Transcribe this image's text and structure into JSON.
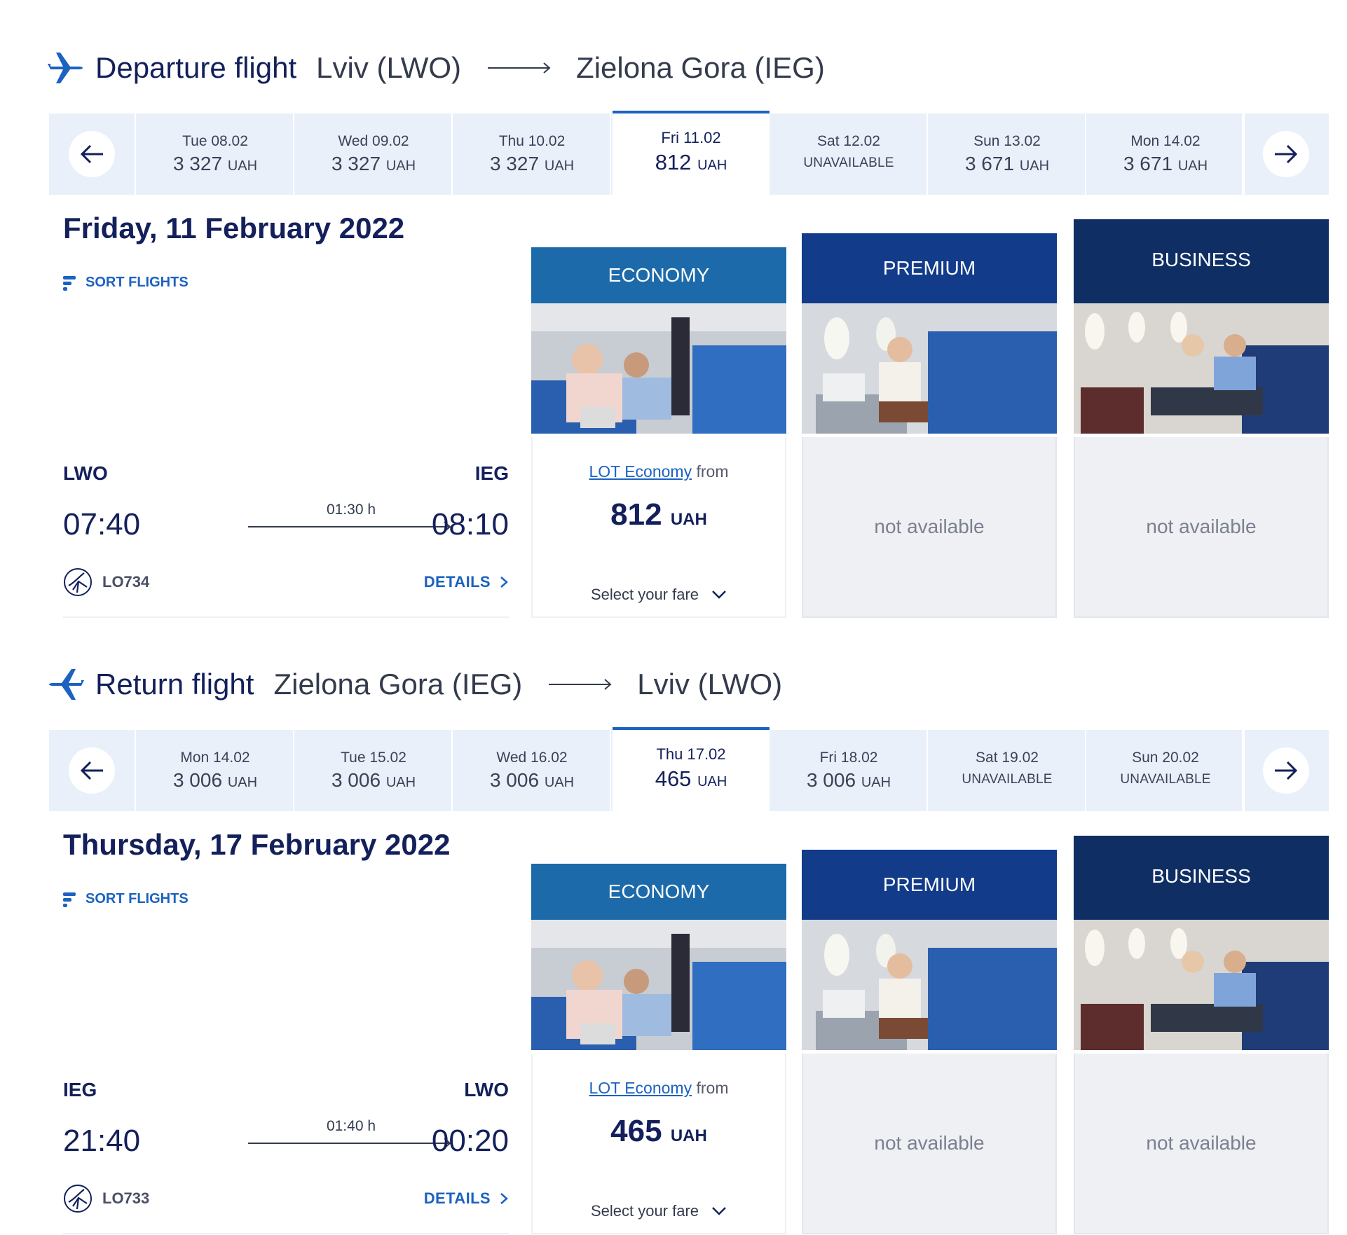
{
  "departure": {
    "header": {
      "label": "Departure flight",
      "from_city": "Lviv (LWO)",
      "to_city": "Zielona Gora (IEG)"
    },
    "dates": [
      {
        "label": "Tue 08.02",
        "amount": "3 327",
        "currency": "UAH",
        "unavailable_text": ""
      },
      {
        "label": "Wed 09.02",
        "amount": "3 327",
        "currency": "UAH",
        "unavailable_text": ""
      },
      {
        "label": "Thu 10.02",
        "amount": "3 327",
        "currency": "UAH",
        "unavailable_text": ""
      },
      {
        "label": "Fri 11.02",
        "amount": "812",
        "currency": "UAH",
        "unavailable_text": "",
        "selected": true
      },
      {
        "label": "Sat 12.02",
        "amount": "",
        "currency": "",
        "unavailable_text": "UNAVAILABLE"
      },
      {
        "label": "Sun 13.02",
        "amount": "3 671",
        "currency": "UAH",
        "unavailable_text": ""
      },
      {
        "label": "Mon 14.02",
        "amount": "3 671",
        "currency": "UAH",
        "unavailable_text": ""
      }
    ],
    "date_title": "Friday, 11 February 2022",
    "sort_label": "SORT FLIGHTS",
    "flight": {
      "from_code": "LWO",
      "to_code": "IEG",
      "dep_time": "07:40",
      "arr_time": "08:10",
      "duration": "01:30 h",
      "flight_no": "LO734",
      "details_label": "DETAILS"
    },
    "fares": {
      "economy": {
        "title": "ECONOMY",
        "link": "LOT Economy",
        "from": "from",
        "price": "812",
        "currency": "UAH",
        "select_label": "Select your fare"
      },
      "premium": {
        "title": "PREMIUM",
        "status": "not available"
      },
      "business": {
        "title": "BUSINESS",
        "status": "not available"
      }
    }
  },
  "return": {
    "header": {
      "label": "Return flight",
      "from_city": "Zielona Gora (IEG)",
      "to_city": "Lviv (LWO)"
    },
    "dates": [
      {
        "label": "Mon 14.02",
        "amount": "3 006",
        "currency": "UAH",
        "unavailable_text": ""
      },
      {
        "label": "Tue 15.02",
        "amount": "3 006",
        "currency": "UAH",
        "unavailable_text": ""
      },
      {
        "label": "Wed 16.02",
        "amount": "3 006",
        "currency": "UAH",
        "unavailable_text": ""
      },
      {
        "label": "Thu 17.02",
        "amount": "465",
        "currency": "UAH",
        "unavailable_text": "",
        "selected": true
      },
      {
        "label": "Fri 18.02",
        "amount": "3 006",
        "currency": "UAH",
        "unavailable_text": ""
      },
      {
        "label": "Sat 19.02",
        "amount": "",
        "currency": "",
        "unavailable_text": "UNAVAILABLE"
      },
      {
        "label": "Sun 20.02",
        "amount": "",
        "currency": "",
        "unavailable_text": "UNAVAILABLE"
      }
    ],
    "date_title": "Thursday, 17 February 2022",
    "sort_label": "SORT FLIGHTS",
    "flight": {
      "from_code": "IEG",
      "to_code": "LWO",
      "dep_time": "21:40",
      "arr_time": "00:20",
      "duration": "01:40 h",
      "flight_no": "LO733",
      "details_label": "DETAILS"
    },
    "fares": {
      "economy": {
        "title": "ECONOMY",
        "link": "LOT Economy",
        "from": "from",
        "price": "465",
        "currency": "UAH",
        "select_label": "Select your fare"
      },
      "premium": {
        "title": "PREMIUM",
        "status": "not available"
      },
      "business": {
        "title": "BUSINESS",
        "status": "not available"
      }
    }
  },
  "colors": {
    "primary_navy": "#13205b",
    "link_blue": "#1c62c0",
    "economy": "#1c6aaa",
    "premium": "#123b8a",
    "business": "#0f2e63",
    "strip_bg": "#e9f0fa"
  },
  "icons": {
    "departure": "plane-takeoff-icon",
    "return": "plane-landing-icon",
    "prev": "arrow-left-icon",
    "next": "arrow-right-icon",
    "sort": "sort-icon",
    "airline": "lot-crane-logo-icon",
    "details": "chevron-right-icon",
    "select": "chevron-down-icon"
  }
}
